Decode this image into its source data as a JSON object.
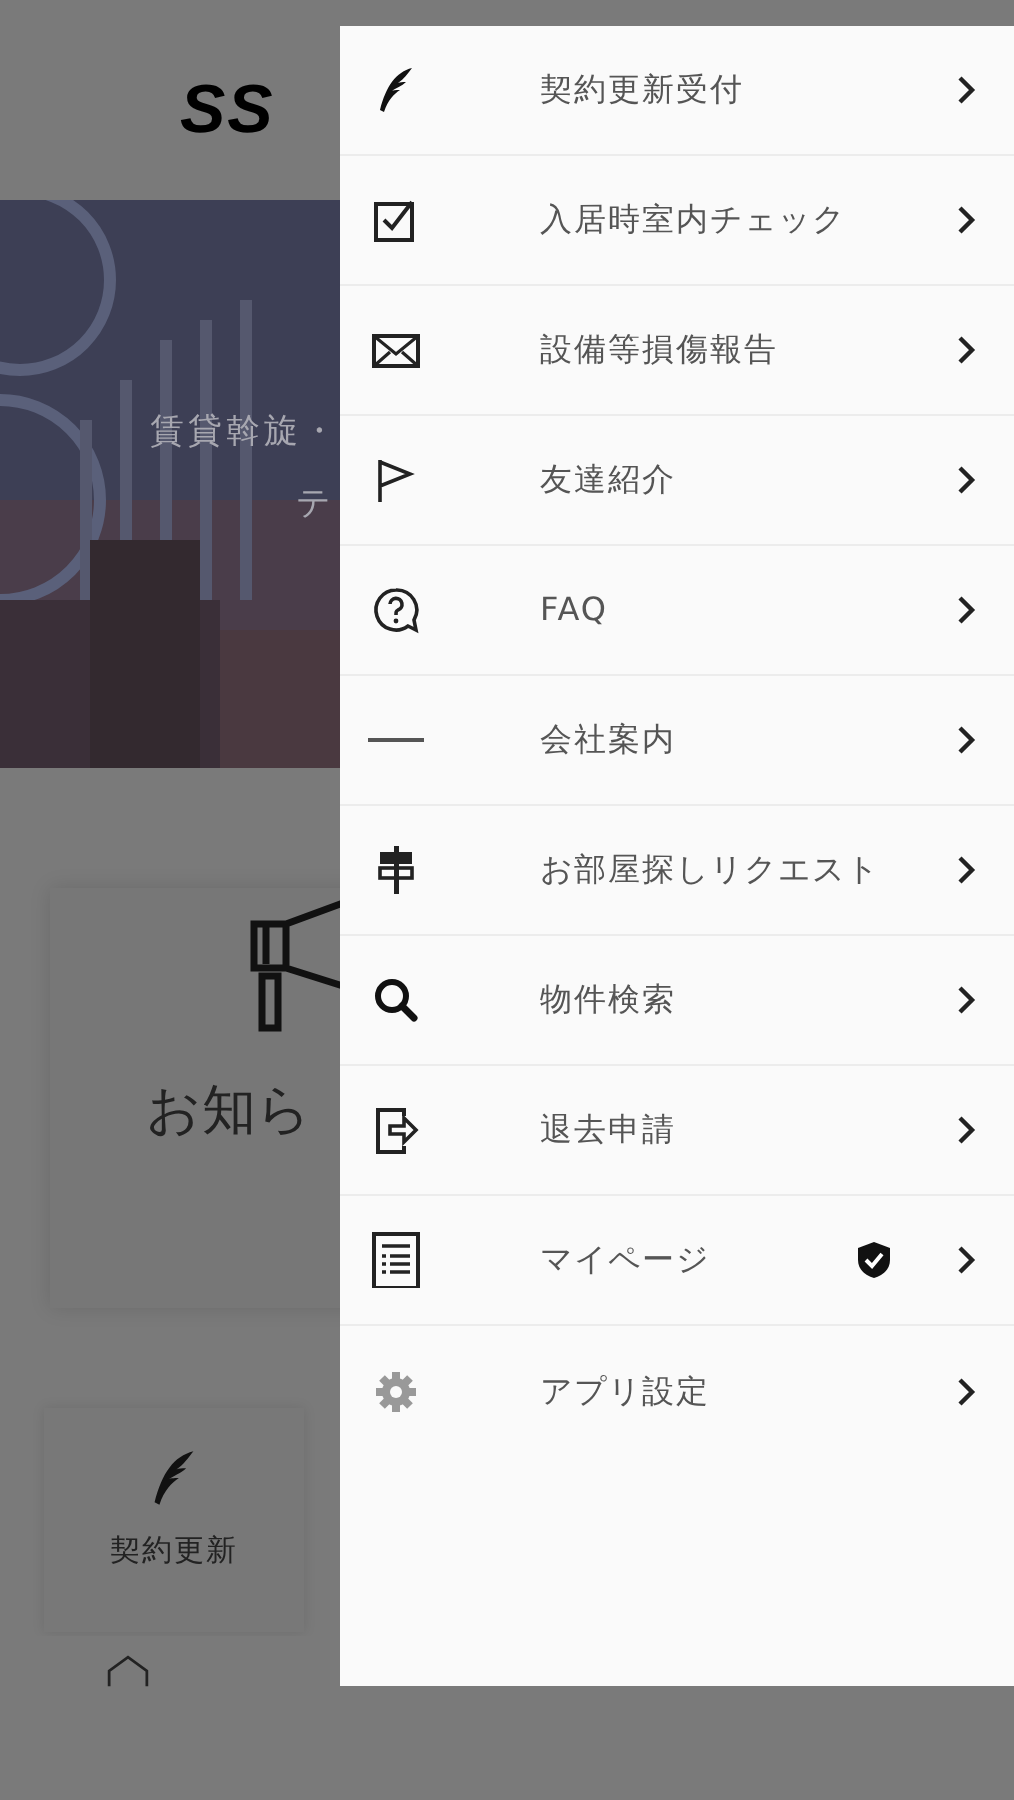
{
  "background": {
    "logo": "SS",
    "banner_lines": [
      "賃貸斡旋・",
      "テ"
    ],
    "notice_card": {
      "label": "お知ら"
    },
    "tiles": [
      {
        "kind": "feather",
        "label": "契約更新"
      }
    ],
    "bottom_nav": [
      {
        "kind": "home"
      }
    ]
  },
  "drawer": {
    "items": [
      {
        "kind": "feather",
        "label": "契約更新受付",
        "verified": false
      },
      {
        "kind": "checkbox",
        "label": "入居時室内チェック",
        "verified": false
      },
      {
        "kind": "envelope",
        "label": "設備等損傷報告",
        "verified": false
      },
      {
        "kind": "flag",
        "label": "友達紹介",
        "verified": false
      },
      {
        "kind": "question",
        "label": "FAQ",
        "verified": false
      },
      {
        "kind": "logo",
        "label": "会社案内",
        "verified": false
      },
      {
        "kind": "signpost",
        "label": "お部屋探しリクエスト",
        "verified": false
      },
      {
        "kind": "search",
        "label": "物件検索",
        "verified": false
      },
      {
        "kind": "exit",
        "label": "退去申請",
        "verified": false
      },
      {
        "kind": "document",
        "label": "マイページ",
        "verified": true
      },
      {
        "kind": "gear",
        "label": "アプリ設定",
        "verified": false
      }
    ]
  }
}
